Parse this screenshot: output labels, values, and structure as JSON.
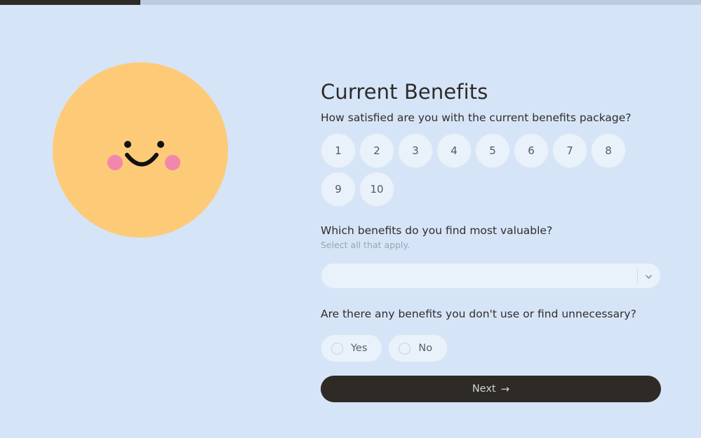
{
  "progress": {
    "percent": 20,
    "fill_color": "#2e2a26",
    "track_color": "#bccbdd"
  },
  "theme": {
    "background": "#d6e4f8",
    "field_background": "#e9f1fa",
    "accent_dark": "#2e2a26",
    "face_yellow": "#fdcb78",
    "cheek_pink": "#f286ad",
    "eye_black": "#111111"
  },
  "illustration": {
    "name": "smiling-face",
    "eye_left": "eye-icon",
    "eye_right": "eye-icon",
    "cheek_left": "cheek-blush",
    "cheek_right": "cheek-blush",
    "mouth": "smile-arc"
  },
  "header": {
    "title": "Current Benefits"
  },
  "questions": [
    {
      "id": "satisfaction",
      "label": "How satisfied are you with the current benefits package?",
      "type": "rating-scale",
      "options": [
        "1",
        "2",
        "3",
        "4",
        "5",
        "6",
        "7",
        "8",
        "9",
        "10"
      ],
      "selected": null
    },
    {
      "id": "valuable-benefits",
      "label": "Which benefits do you find most valuable?",
      "helper": "Select all that apply.",
      "type": "multiselect",
      "value": "",
      "placeholder": "",
      "chevron": "chevron-down-icon"
    },
    {
      "id": "unused-benefits",
      "label": "Are there any benefits you don't use or find unnecessary?",
      "type": "radio",
      "options": [
        "Yes",
        "No"
      ],
      "selected": null
    }
  ],
  "footer": {
    "next_label": "Next",
    "next_arrow": "→"
  }
}
